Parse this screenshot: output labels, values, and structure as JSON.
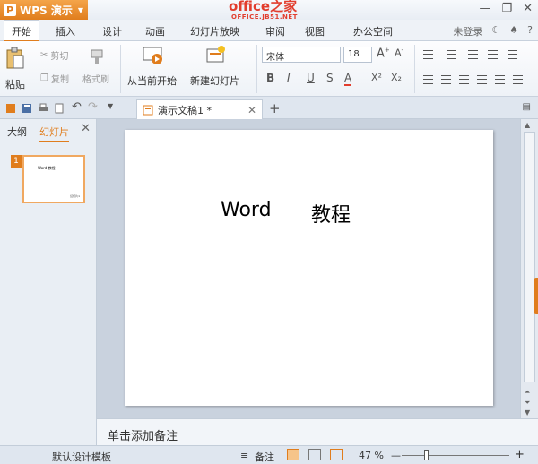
{
  "titlebar": {
    "app_name": "WPS 演示",
    "logo_char": "P",
    "watermark": "office之家",
    "watermark_sub": "OFFICE.JB51.NET"
  },
  "tabs": {
    "items": [
      "开始",
      "插入",
      "设计",
      "动画",
      "幻灯片放映",
      "审阅",
      "视图",
      "办公空间"
    ],
    "active": "开始",
    "login": "未登录",
    "help": "?"
  },
  "ribbon": {
    "paste": "粘贴",
    "cut": "剪切",
    "copy": "复制",
    "format_painter": "格式刷",
    "play_from_current": "从当前开始",
    "new_slide": "新建幻灯片",
    "font_name": "宋体",
    "font_size": "18",
    "bold": "B",
    "italic": "I",
    "underline": "U",
    "strike": "S",
    "font_color": "A",
    "superscript": "X²",
    "subscript": "X₂"
  },
  "docbar": {
    "tab_title": "演示文稿1 *"
  },
  "leftpane": {
    "outline_tab": "大纲",
    "slides_tab": "幻灯片",
    "thumb_number": "1",
    "thumb_text": "Word 教程",
    "thumb_foot": "幻灯片1"
  },
  "slide": {
    "text_left": "Word",
    "text_right": "教程"
  },
  "notes": {
    "placeholder": "单击添加备注"
  },
  "statusbar": {
    "template": "默认设计模板",
    "notes_btn": "备注",
    "zoom": "47 %"
  },
  "colors": {
    "accent": "#e07d1d",
    "watermark": "#e23d2d"
  }
}
